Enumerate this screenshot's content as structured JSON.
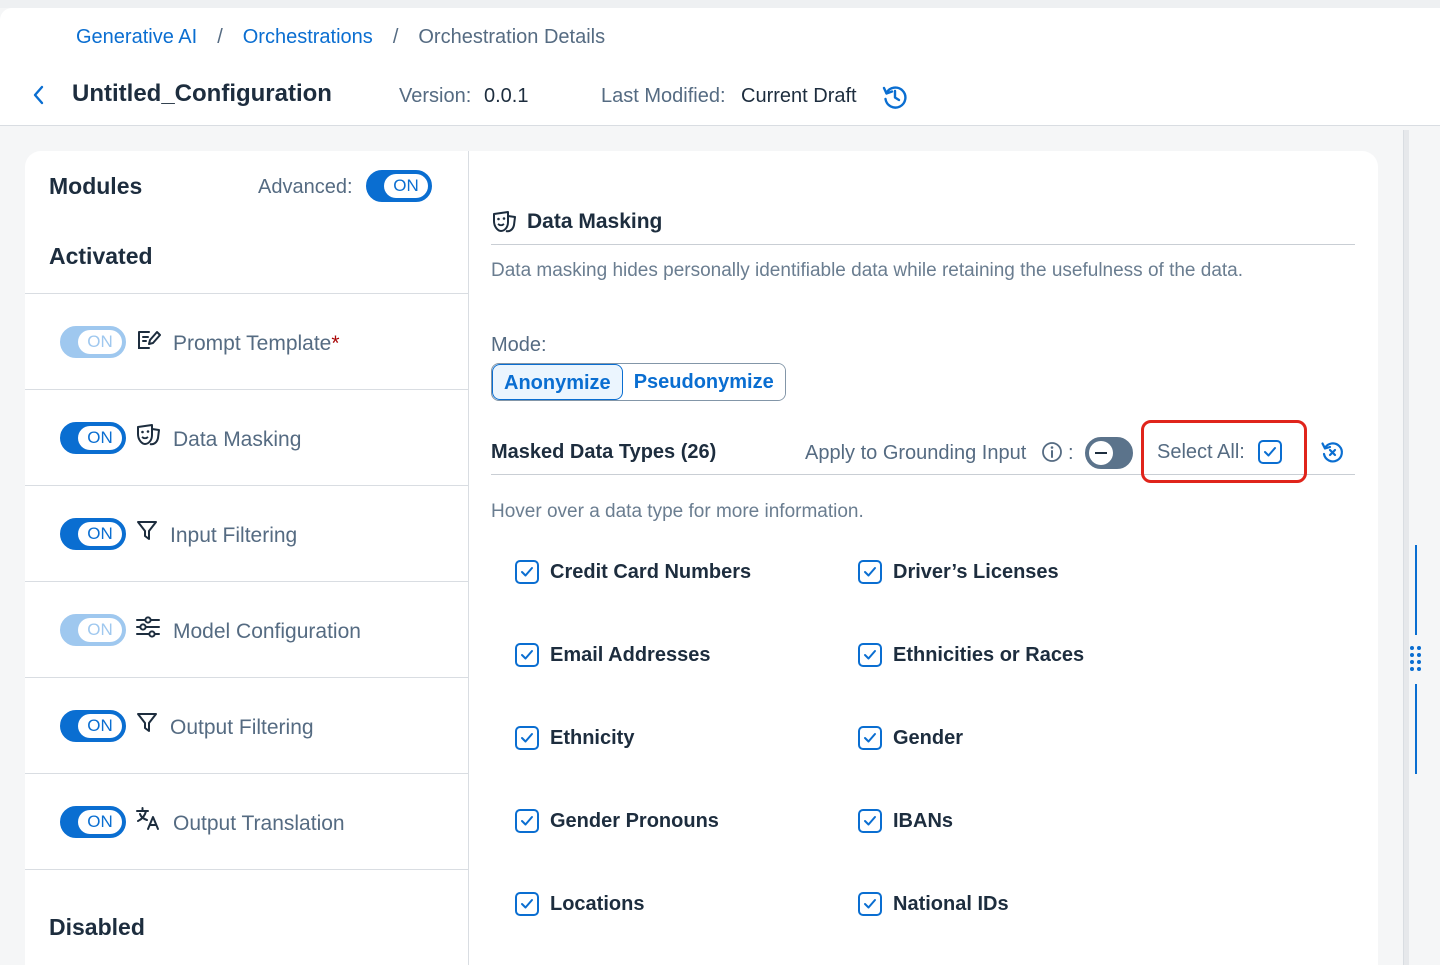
{
  "breadcrumb": {
    "items": [
      "Generative AI",
      "Orchestrations",
      "Orchestration Details"
    ],
    "separator": "/"
  },
  "header": {
    "title": "Untitled_Configuration",
    "version_label": "Version:",
    "version_value": "0.0.1",
    "modified_label": "Last Modified:",
    "modified_value": "Current Draft"
  },
  "modules": {
    "title": "Modules",
    "advanced_label": "Advanced:",
    "advanced_state": "ON",
    "activated_title": "Activated",
    "disabled_title": "Disabled",
    "items": [
      {
        "label": "Prompt Template",
        "required_mark": "*",
        "switch": "ON",
        "switch_disabled": true,
        "icon": "prompt-edit-icon"
      },
      {
        "label": "Data Masking",
        "switch": "ON",
        "switch_disabled": false,
        "icon": "mask-icon"
      },
      {
        "label": "Input Filtering",
        "switch": "ON",
        "switch_disabled": false,
        "icon": "filter-icon"
      },
      {
        "label": "Model Configuration",
        "switch": "ON",
        "switch_disabled": true,
        "icon": "sliders-icon"
      },
      {
        "label": "Output Filtering",
        "switch": "ON",
        "switch_disabled": false,
        "icon": "filter-icon"
      },
      {
        "label": "Output Translation",
        "switch": "ON",
        "switch_disabled": false,
        "icon": "translate-icon"
      }
    ]
  },
  "data_masking": {
    "title": "Data Masking",
    "description": "Data masking hides personally identifiable data while retaining the usefulness of the data.",
    "mode_label": "Mode:",
    "modes": [
      "Anonymize",
      "Pseudonymize"
    ],
    "active_mode": "Anonymize",
    "masked_types_title": "Masked Data Types (26)",
    "grounding_label": "Apply to Grounding Input",
    "grounding_colon": ":",
    "grounding_enabled": false,
    "select_all_label": "Select All:",
    "select_all_checked": true,
    "hover_hint": "Hover over a data type for more information.",
    "types_col1": [
      "Credit Card Numbers",
      "Email Addresses",
      "Ethnicity",
      "Gender Pronouns",
      "Locations"
    ],
    "types_col2": [
      "Driver’s Licenses",
      "Ethnicities or Races",
      "Gender",
      "IBANs",
      "National IDs"
    ]
  },
  "colors": {
    "accent": "#0a6ed1",
    "highlight": "#e0241b",
    "text": "#1d2d3e",
    "muted": "#556b82"
  }
}
